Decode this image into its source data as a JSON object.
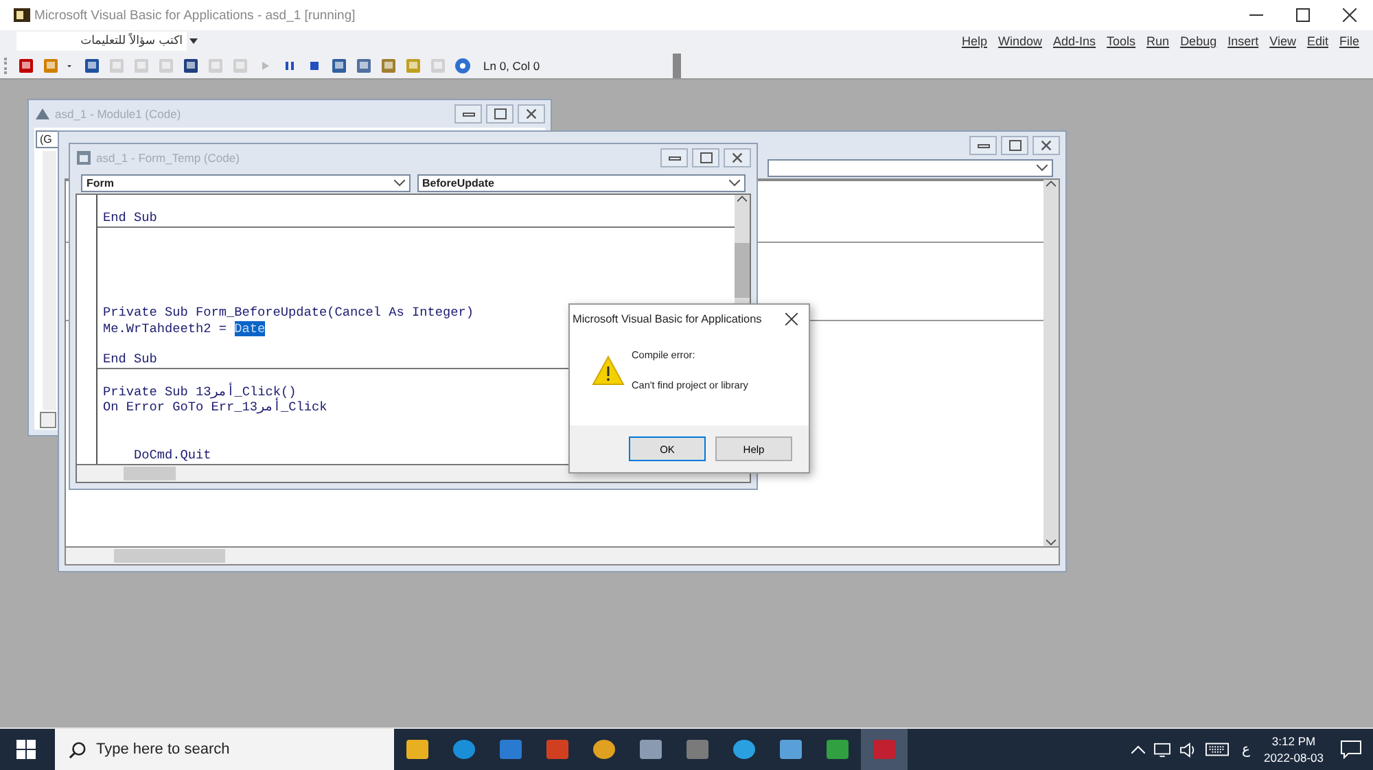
{
  "window": {
    "title": "Microsoft Visual Basic for Applications - asd_1 [running]"
  },
  "help_box": {
    "placeholder": "اكتب سؤالاً للتعليمات"
  },
  "menu": [
    "Help",
    "Window",
    "Add-Ins",
    "Tools",
    "Run",
    "Debug",
    "Insert",
    "View",
    "Edit",
    "File"
  ],
  "toolbar": {
    "position": "Ln 0, Col 0"
  },
  "module_window": {
    "title": "asd_1 - Module1 (Code)",
    "object_combo": "(G"
  },
  "form_window": {
    "title": "asd_1 - Form_Temp (Code)",
    "object_combo": "Form",
    "procedure_combo": "BeforeUpdate",
    "lines": [
      {
        "kind": "blank"
      },
      {
        "kind": "code",
        "segments": [
          {
            "text": "End Sub",
            "selected": false
          }
        ]
      },
      {
        "kind": "separator"
      },
      {
        "kind": "blank"
      },
      {
        "kind": "blank"
      },
      {
        "kind": "blank"
      },
      {
        "kind": "blank"
      },
      {
        "kind": "blank"
      },
      {
        "kind": "code",
        "segments": [
          {
            "text": "Private Sub Form_BeforeUpdate(Cancel As Integer)",
            "selected": false
          }
        ]
      },
      {
        "kind": "code",
        "segments": [
          {
            "text": "Me.WrTahdeeth2 = ",
            "selected": false
          },
          {
            "text": "Date",
            "selected": true
          }
        ]
      },
      {
        "kind": "blank"
      },
      {
        "kind": "code",
        "segments": [
          {
            "text": "End Sub",
            "selected": false
          }
        ]
      },
      {
        "kind": "separator"
      },
      {
        "kind": "blank"
      },
      {
        "kind": "code",
        "segments": [
          {
            "text": "Private Sub أمر13_Click()",
            "selected": false
          }
        ]
      },
      {
        "kind": "code",
        "segments": [
          {
            "text": "On Error GoTo Err_أمر13_Click",
            "selected": false
          }
        ]
      },
      {
        "kind": "blank"
      },
      {
        "kind": "blank"
      },
      {
        "kind": "code",
        "segments": [
          {
            "text": "    DoCmd.Quit",
            "selected": false
          }
        ]
      }
    ]
  },
  "dialog": {
    "title": "Microsoft Visual Basic for Applications",
    "heading": "Compile error:",
    "message": "Can't find project or library",
    "buttons": [
      "OK",
      "Help"
    ]
  },
  "taskbar": {
    "search_placeholder": "Type here to search",
    "apps": [
      {
        "selected": false
      },
      {
        "selected": false
      },
      {
        "selected": false
      },
      {
        "selected": false
      },
      {
        "selected": false
      },
      {
        "selected": false
      },
      {
        "selected": false
      },
      {
        "selected": false
      },
      {
        "selected": false
      },
      {
        "selected": false
      },
      {
        "selected": true
      }
    ],
    "input_indicator": "ع",
    "time": "3:12 PM",
    "date": "2022-08-03"
  }
}
